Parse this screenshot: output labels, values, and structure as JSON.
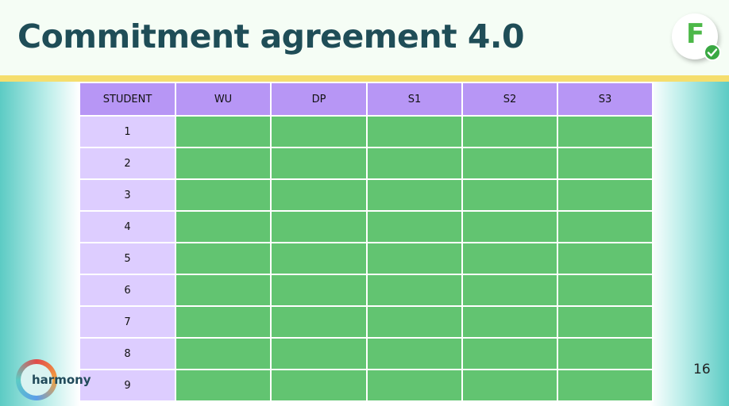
{
  "slide": {
    "title": "Commitment agreement 4.0",
    "page_number": "16",
    "logo_letter": "F",
    "brand": "harmony"
  },
  "table": {
    "headers": [
      "STUDENT",
      "WU",
      "DP",
      "S1",
      "S2",
      "S3"
    ],
    "rows": [
      "1",
      "2",
      "3",
      "4",
      "5",
      "6",
      "7",
      "8",
      "9"
    ]
  },
  "colors": {
    "title": "#1f4d57",
    "accent_bar": "#f5de6e",
    "header_cell": "#b796f5",
    "student_cell": "#ddcdff",
    "data_cell": "#62c471",
    "logo_green": "#4cb848"
  }
}
